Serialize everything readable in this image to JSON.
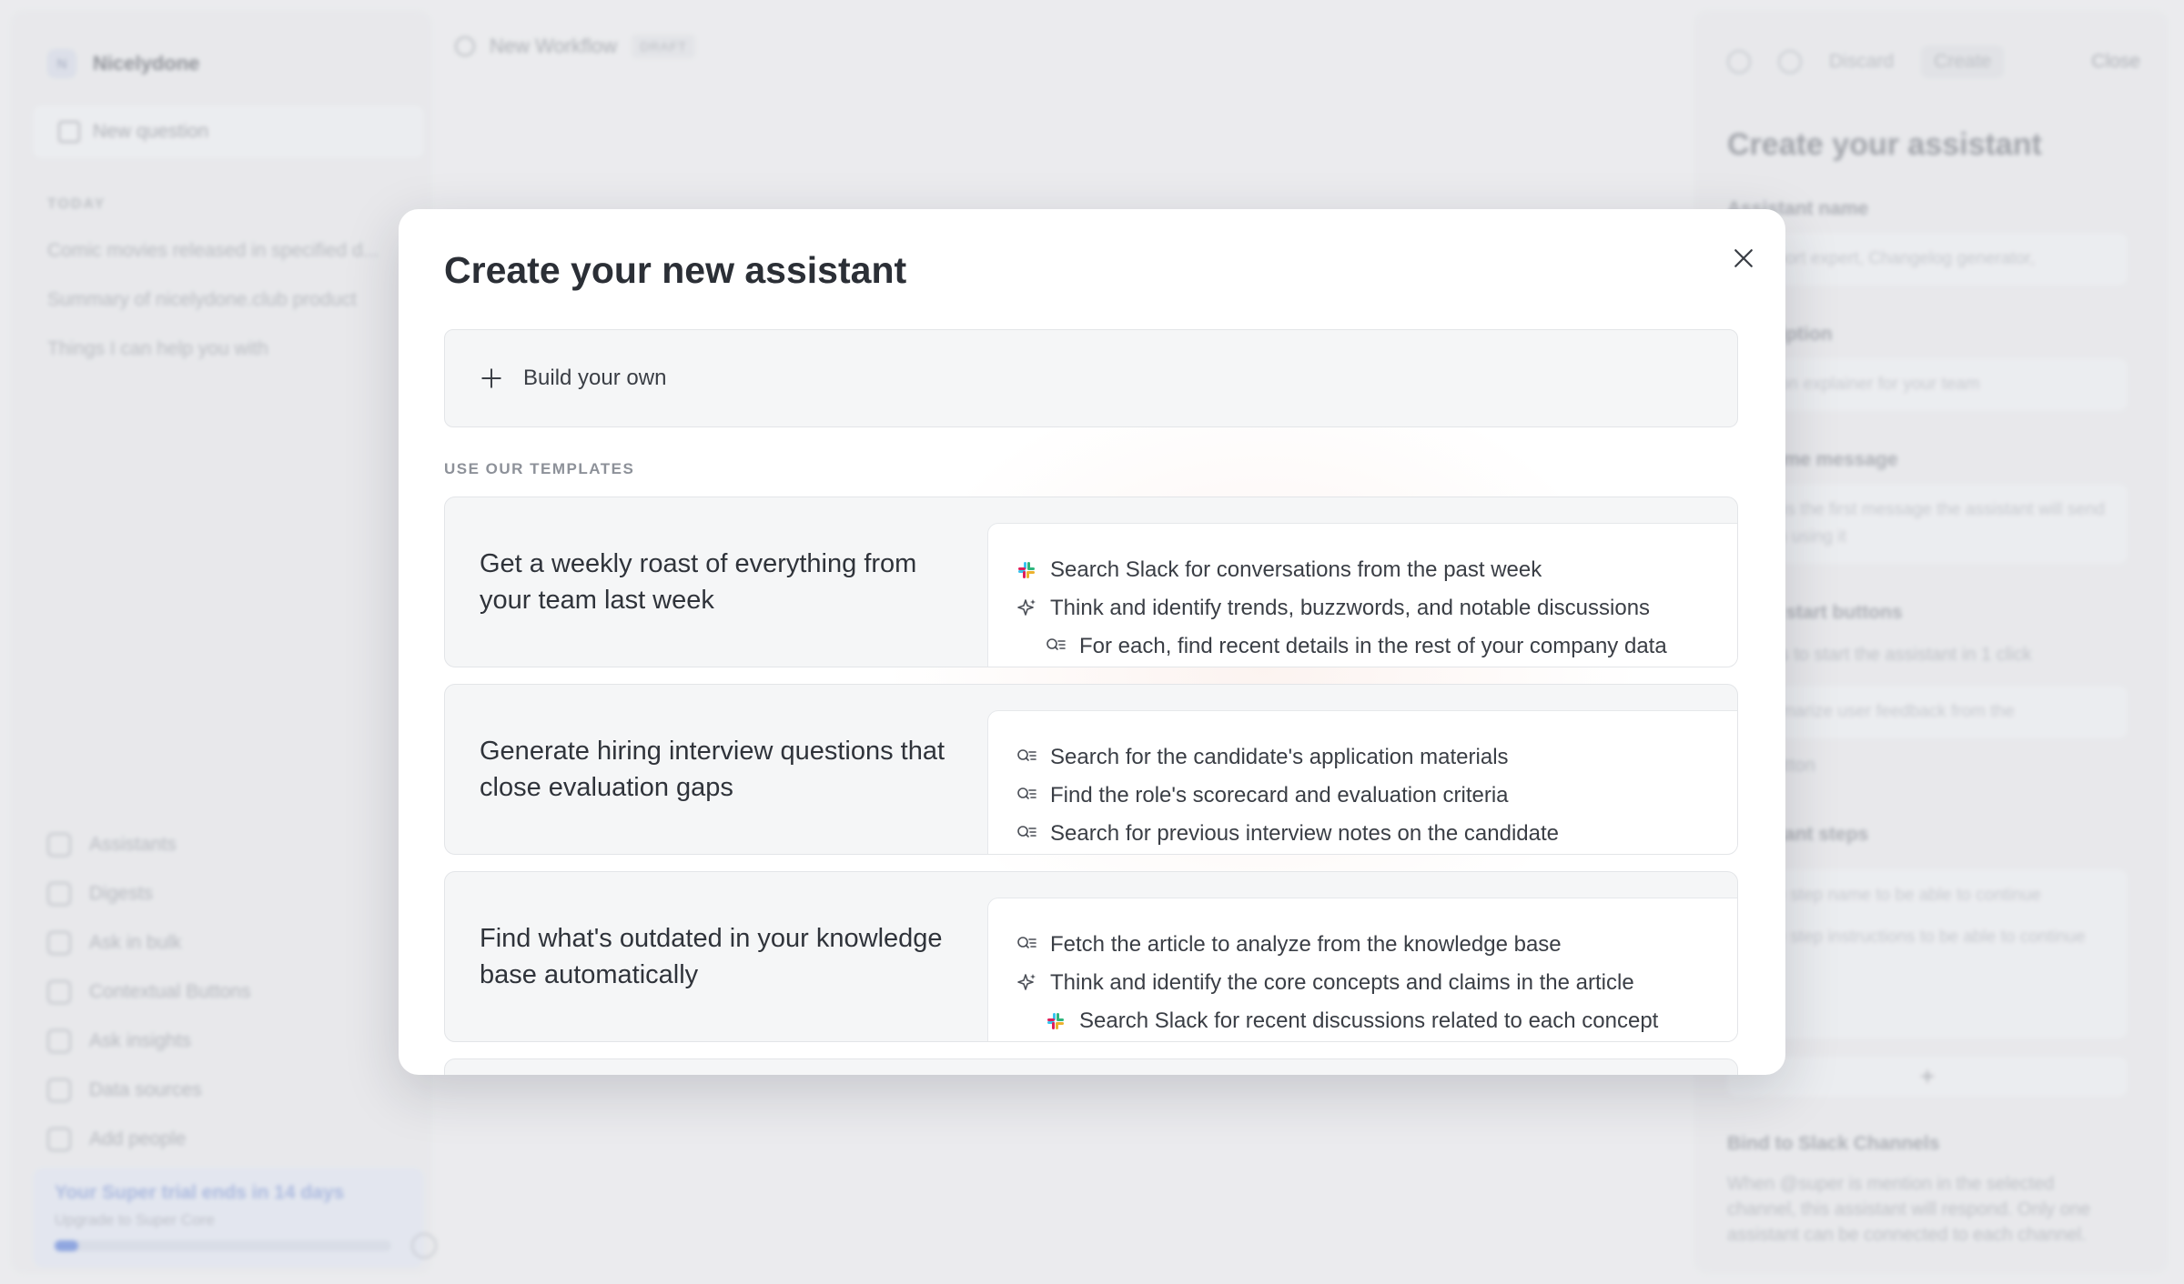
{
  "app": {
    "brand_initial": "N",
    "brand_name": "Nicelydone",
    "new_question": "New question",
    "today_label": "TODAY",
    "history": [
      "Comic movies released in specified d...",
      "Summary of nicelydone.club product",
      "Things I can help you with"
    ],
    "nav": [
      {
        "label": "Assistants",
        "icon": "sparkle-icon"
      },
      {
        "label": "Digests",
        "icon": "digest-icon"
      },
      {
        "label": "Ask in bulk",
        "icon": "list-icon"
      },
      {
        "label": "Contextual Buttons",
        "icon": "contextual-icon"
      },
      {
        "label": "Ask insights",
        "icon": "insights-icon"
      },
      {
        "label": "Data sources",
        "icon": "database-icon"
      },
      {
        "label": "Add people",
        "icon": "person-icon"
      }
    ],
    "trial": {
      "title": "Your Super trial ends in 14 days",
      "subtitle": "Upgrade to Super Core",
      "progress": 0.07
    }
  },
  "workflow": {
    "title": "New Workflow",
    "badge": "DRAFT"
  },
  "right_panel": {
    "discard": "Discard",
    "create": "Create",
    "close": "Close",
    "heading": "Create your assistant",
    "name_label": "Assistant name",
    "name_placeholder": "Support expert, Changelog generator,",
    "description_label": "Description",
    "description_placeholder": "Jargon explainer for your team",
    "welcome_label": "Welcome message",
    "welcome_placeholder": "This is the first message the assistant will send when using it",
    "quickstart_label": "Quick start buttons",
    "quickstart_hint": "Buttons to start the assistant in 1 click",
    "quickstart_value": "Summarize user feedback from the",
    "add_button": "Add button",
    "steps_label": "Assistant steps",
    "step_name_placeholder": "Write step name to be able to continue",
    "step_instructions_placeholder": "Write step instructions to be able to continue",
    "add_step": "+",
    "slack_label": "Bind to Slack Channels",
    "slack_text": "When @super is mention in the selected channel, this assistant will respond. Only one assistant can be connected to each channel."
  },
  "modal": {
    "title": "Create your new assistant",
    "build_own": "Build your own",
    "templates_heading": "USE OUR TEMPLATES",
    "templates": [
      {
        "title": "Get a weekly roast of everything from your team last week",
        "steps": [
          {
            "icon": "slack-icon",
            "text": "Search Slack for conversations from the past week",
            "indent": false
          },
          {
            "icon": "sparkle-icon",
            "text": "Think and identify trends, buzzwords, and notable discussions",
            "indent": false
          },
          {
            "icon": "search-doc-icon",
            "text": "For each, find recent details in the rest of your company data",
            "indent": true
          }
        ]
      },
      {
        "title": "Generate hiring interview questions that close evaluation gaps",
        "steps": [
          {
            "icon": "search-doc-icon",
            "text": "Search for the candidate's application materials",
            "indent": false
          },
          {
            "icon": "search-doc-icon",
            "text": "Find the role's scorecard and evaluation criteria",
            "indent": false
          },
          {
            "icon": "search-doc-icon",
            "text": "Search for previous interview notes on the candidate",
            "indent": false
          }
        ]
      },
      {
        "title": "Find what's outdated in your knowledge base automatically",
        "steps": [
          {
            "icon": "search-doc-icon",
            "text": "Fetch the article to analyze from the knowledge base",
            "indent": false
          },
          {
            "icon": "sparkle-icon",
            "text": "Think and identify the core concepts and claims in the article",
            "indent": false
          },
          {
            "icon": "slack-icon",
            "text": "Search Slack for recent discussions related to each concept",
            "indent": true
          }
        ]
      }
    ]
  }
}
